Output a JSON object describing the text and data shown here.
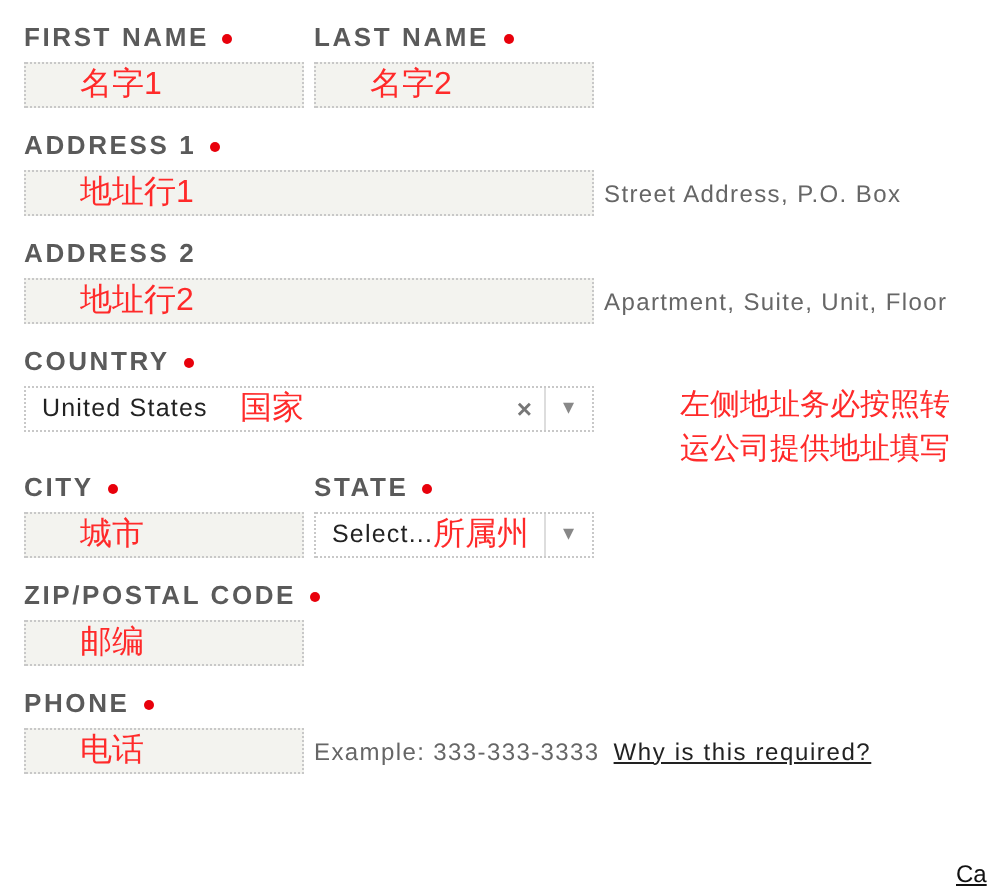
{
  "rows": [
    {
      "fields": [
        {
          "label": "FIRST NAME",
          "required": true,
          "kind": "text",
          "value": "名字1"
        },
        {
          "label": "LAST NAME",
          "required": true,
          "kind": "text",
          "value": "名字2"
        }
      ]
    },
    {
      "fields": [
        {
          "label": "ADDRESS 1",
          "required": true,
          "kind": "text",
          "value": "地址行1",
          "hint": "Street Address, P.O. Box"
        }
      ]
    },
    {
      "fields": [
        {
          "label": "ADDRESS 2",
          "required": false,
          "kind": "text",
          "value": "地址行2",
          "hint": "Apartment, Suite, Unit, Floor"
        }
      ]
    },
    {
      "fields": [
        {
          "label": "COUNTRY",
          "required": true,
          "kind": "select",
          "value": "United States",
          "annotation": "国家",
          "clear": "×",
          "caret": "▾"
        }
      ],
      "note": "左侧地址务必按照转运公司提供地址填写"
    },
    {
      "fields": [
        {
          "label": "CITY",
          "required": true,
          "kind": "text",
          "value": "城市"
        },
        {
          "label": "STATE",
          "required": true,
          "kind": "select",
          "value": "Select...",
          "annotation": "所属州",
          "caret": "▾"
        }
      ]
    },
    {
      "fields": [
        {
          "label": "ZIP/POSTAL CODE",
          "required": true,
          "kind": "text",
          "value": "邮编"
        }
      ]
    },
    {
      "fields": [
        {
          "label": "PHONE",
          "required": true,
          "kind": "text",
          "value": "电话",
          "hint": "Example: 333-333-3333",
          "link": "Why is this required?"
        }
      ]
    }
  ],
  "footer_link": "Ca"
}
